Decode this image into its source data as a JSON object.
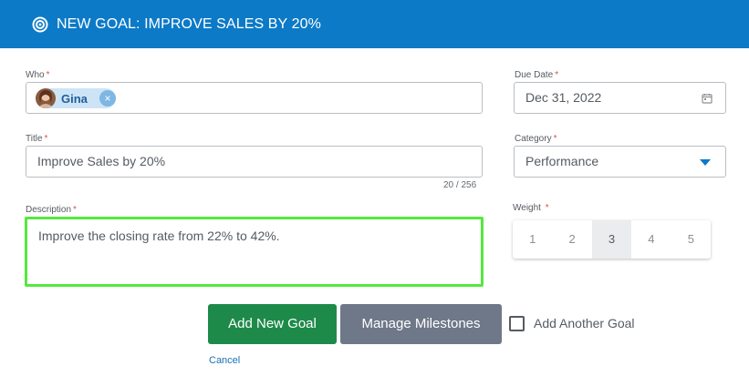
{
  "header": {
    "title": "NEW GOAL: IMPROVE SALES BY 20%",
    "icon": "target-icon",
    "color": "#0c7ac7"
  },
  "who": {
    "label": "Who",
    "required": "*",
    "chip_name": "Gina",
    "remove_icon": "×"
  },
  "due_date": {
    "label": "Due Date",
    "required": "*",
    "value": "Dec 31, 2022",
    "icon": "calendar-icon"
  },
  "title_field": {
    "label": "Title",
    "required": "*",
    "value": "Improve Sales by 20%",
    "counter": "20 / 256"
  },
  "category": {
    "label": "Category",
    "required": "*",
    "value": "Performance"
  },
  "description": {
    "label": "Description",
    "required": "*",
    "value": "Improve the closing rate from 22% to 42%.",
    "highlight_color": "#55e83f"
  },
  "weight": {
    "label": "Weight",
    "required": "*",
    "options": [
      "1",
      "2",
      "3",
      "4",
      "5"
    ],
    "selected": "3"
  },
  "actions": {
    "add_label": "Add New Goal",
    "milestones_label": "Manage Milestones",
    "add_another_label": "Add Another Goal",
    "cancel_label": "Cancel"
  }
}
